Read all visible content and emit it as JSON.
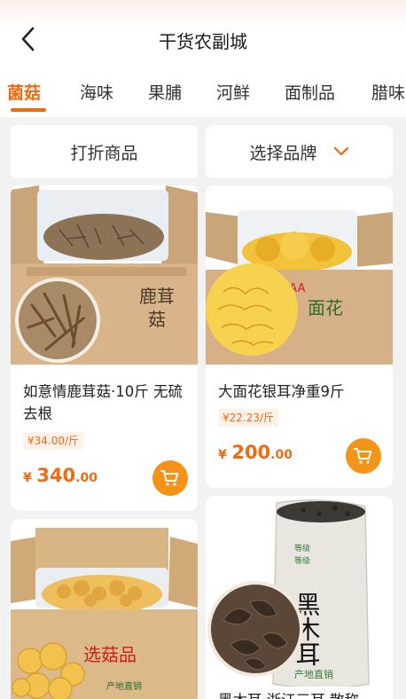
{
  "header": {
    "title": "干货农副城"
  },
  "categories": [
    "菌菇",
    "海味",
    "果脯",
    "河鲜",
    "面制品",
    "腊味"
  ],
  "filters": {
    "discount_label": "打折商品",
    "brand_label": "选择品牌"
  },
  "products": [
    {
      "name": "如意情鹿茸菇·10斤 无硫 去根",
      "unit_price": "¥34.00/斤",
      "price_currency": "¥",
      "price_int": "340",
      "price_dec": ".00",
      "box_text": "鹿茸菇"
    },
    {
      "name": "大面花银耳净重9斤",
      "unit_price": "¥22.23/斤",
      "price_currency": "¥",
      "price_int": "200",
      "price_dec": ".00",
      "box_text": "AAA 面花"
    },
    {
      "box_text": "选菇品",
      "box_subtext": "产地直销"
    },
    {
      "name": "黑木耳 浙江三耳 散称",
      "bag_text": "黑木耳",
      "bag_subtext": "产地直销"
    }
  ],
  "colors": {
    "accent": "#ef6b12",
    "cart": "#f39318"
  }
}
